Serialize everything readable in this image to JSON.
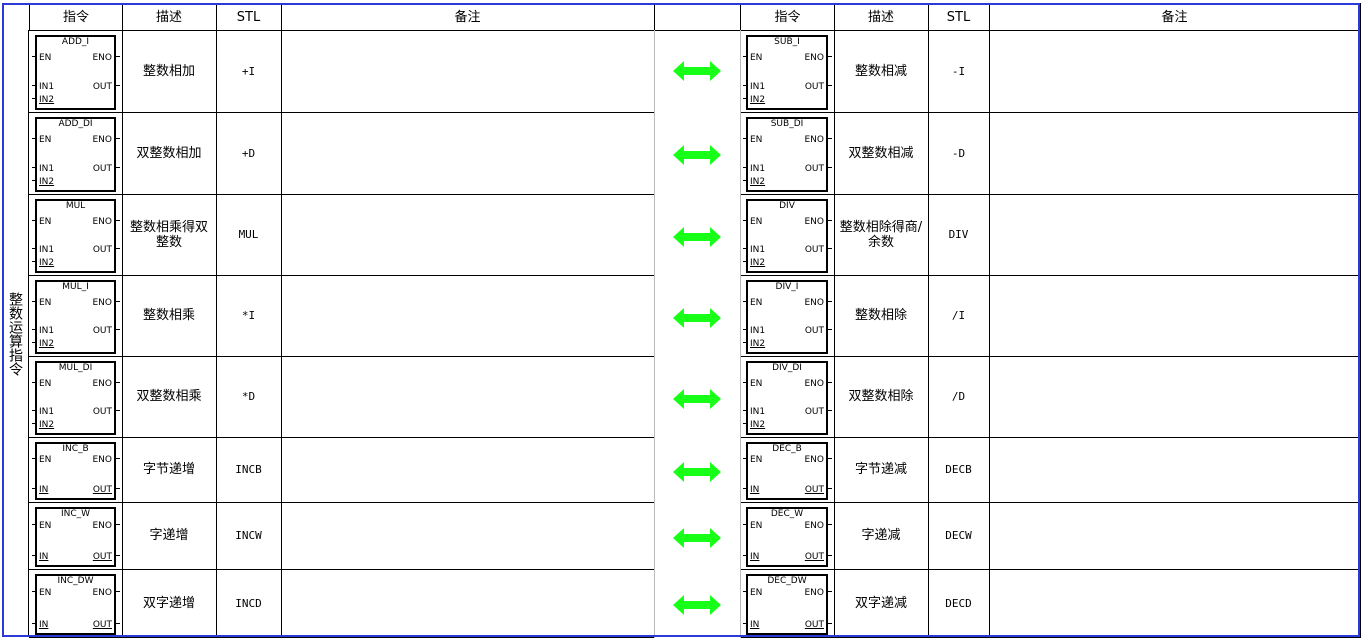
{
  "category": "整数运算指令",
  "headers": {
    "instr": "指令",
    "desc": "描述",
    "stl": "STL",
    "note": "备注"
  },
  "arrow_color": "#18ff18",
  "frame_color": "#2a3ad8",
  "rows": [
    {
      "left": {
        "name": "ADD_I",
        "pins_in": [
          "EN",
          "IN1",
          "IN2"
        ],
        "pins_out": [
          "ENO",
          "OUT"
        ],
        "desc": "整数相加",
        "stl": "+I"
      },
      "right": {
        "name": "SUB_I",
        "pins_in": [
          "EN",
          "IN1",
          "IN2"
        ],
        "pins_out": [
          "ENO",
          "OUT"
        ],
        "desc": "整数相减",
        "stl": "-I"
      }
    },
    {
      "left": {
        "name": "ADD_DI",
        "pins_in": [
          "EN",
          "IN1",
          "IN2"
        ],
        "pins_out": [
          "ENO",
          "OUT"
        ],
        "desc": "双整数相加",
        "stl": "+D"
      },
      "right": {
        "name": "SUB_DI",
        "pins_in": [
          "EN",
          "IN1",
          "IN2"
        ],
        "pins_out": [
          "ENO",
          "OUT"
        ],
        "desc": "双整数相减",
        "stl": "-D"
      }
    },
    {
      "left": {
        "name": "MUL",
        "pins_in": [
          "EN",
          "IN1",
          "IN2"
        ],
        "pins_out": [
          "ENO",
          "OUT"
        ],
        "desc": "整数相乘得双整数",
        "stl": "MUL"
      },
      "right": {
        "name": "DIV",
        "pins_in": [
          "EN",
          "IN1",
          "IN2"
        ],
        "pins_out": [
          "ENO",
          "OUT"
        ],
        "desc": "整数相除得商/余数",
        "stl": "DIV"
      }
    },
    {
      "left": {
        "name": "MUL_I",
        "pins_in": [
          "EN",
          "IN1",
          "IN2"
        ],
        "pins_out": [
          "ENO",
          "OUT"
        ],
        "desc": "整数相乘",
        "stl": "*I"
      },
      "right": {
        "name": "DIV_I",
        "pins_in": [
          "EN",
          "IN1",
          "IN2"
        ],
        "pins_out": [
          "ENO",
          "OUT"
        ],
        "desc": "整数相除",
        "stl": "/I"
      }
    },
    {
      "left": {
        "name": "MUL_DI",
        "pins_in": [
          "EN",
          "IN1",
          "IN2"
        ],
        "pins_out": [
          "ENO",
          "OUT"
        ],
        "desc": "双整数相乘",
        "stl": "*D"
      },
      "right": {
        "name": "DIV_DI",
        "pins_in": [
          "EN",
          "IN1",
          "IN2"
        ],
        "pins_out": [
          "ENO",
          "OUT"
        ],
        "desc": "双整数相除",
        "stl": "/D"
      }
    },
    {
      "left": {
        "name": "INC_B",
        "pins_in": [
          "EN",
          "IN"
        ],
        "pins_out": [
          "ENO",
          "OUT"
        ],
        "desc": "字节递增",
        "stl": "INCB"
      },
      "right": {
        "name": "DEC_B",
        "pins_in": [
          "EN",
          "IN"
        ],
        "pins_out": [
          "ENO",
          "OUT"
        ],
        "desc": "字节递减",
        "stl": "DECB"
      }
    },
    {
      "left": {
        "name": "INC_W",
        "pins_in": [
          "EN",
          "IN"
        ],
        "pins_out": [
          "ENO",
          "OUT"
        ],
        "desc": "字递增",
        "stl": "INCW"
      },
      "right": {
        "name": "DEC_W",
        "pins_in": [
          "EN",
          "IN"
        ],
        "pins_out": [
          "ENO",
          "OUT"
        ],
        "desc": "字递减",
        "stl": "DECW"
      }
    },
    {
      "left": {
        "name": "INC_DW",
        "pins_in": [
          "EN",
          "IN"
        ],
        "pins_out": [
          "ENO",
          "OUT"
        ],
        "desc": "双字递增",
        "stl": "INCD"
      },
      "right": {
        "name": "DEC_DW",
        "pins_in": [
          "EN",
          "IN"
        ],
        "pins_out": [
          "ENO",
          "OUT"
        ],
        "desc": "双字递减",
        "stl": "DECD"
      }
    }
  ]
}
